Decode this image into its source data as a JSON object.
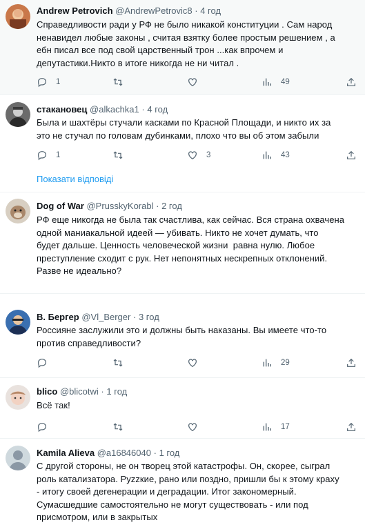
{
  "tweets": [
    {
      "name": "Andrew Petrovich",
      "handle": "@AndrewPetrovic8",
      "dot": "·",
      "time": "4 год",
      "text": "Справедливости ради у РФ не было никакой конституции . Сам народ\nненавидел любые законы , считая взятку более простым решением , а\nебн писал все под свой царственный трон ...как впрочем и\nдепутастики.Никто в итоге никогда не ни читал .",
      "replies": "1",
      "retweets": "",
      "likes": "",
      "views": "49"
    },
    {
      "name": "стакановец",
      "handle": "@alkachka1",
      "dot": "·",
      "time": "4 год",
      "text": "Была и шахтёры стучали касками по Красной Площади, и никто их за\nэто не стучал по головам дубинками, плохо что вы об этом забыли",
      "replies": "1",
      "retweets": "",
      "likes": "3",
      "views": "43"
    },
    {
      "name": "Dog of War",
      "handle": "@PrusskyKorabl",
      "dot": "·",
      "time": "2 год",
      "text": "РФ еще никогда не была так счастлива, как сейчас. Вся страна охвачена\nодной маниакальной идеей — убивать. Никто не хочет думать, что\nбудет дальше. Ценность человеческой жизни  равна нулю. Любое\nпреступление сходит с рук. Нет непонятных нескрепных отклонений.\nРазве не идеально?"
    },
    {
      "name": "В. Бергер",
      "handle": "@Vl_Berger",
      "dot": "·",
      "time": "3 год",
      "text": "Россияне заслужили это и должны быть наказаны. Вы имеете что-то\nпротив справедливости?",
      "replies": "",
      "retweets": "",
      "likes": "",
      "views": "29"
    },
    {
      "name": "blico",
      "handle": "@blicotwi",
      "dot": "·",
      "time": "1 год",
      "text": "Всё так!",
      "replies": "",
      "retweets": "",
      "likes": "",
      "views": "17"
    },
    {
      "name": "Kamila Alieva",
      "handle": "@a16846040",
      "dot": "·",
      "time": "1 год",
      "text": "С другой стороны, не он творец этой катастрофы. Он, скорее, сыграл\nроль катализатора. Pyzzкие, рано или поздно, пришли бы к этому краху\n- итогу своей дегенерации и деградации. Итог закономерный.\nСумасшедшие самостоятельно не могут существовать - или под\nприсмотром, или в закрытых"
    }
  ],
  "show_replies": "Показати відповіді",
  "colors": {
    "link": "#1d9bf0",
    "muted": "#536471",
    "highlight_bg": "#f7f9f9"
  },
  "icons": [
    "reply-icon",
    "retweet-icon",
    "like-icon",
    "views-icon",
    "share-icon"
  ]
}
